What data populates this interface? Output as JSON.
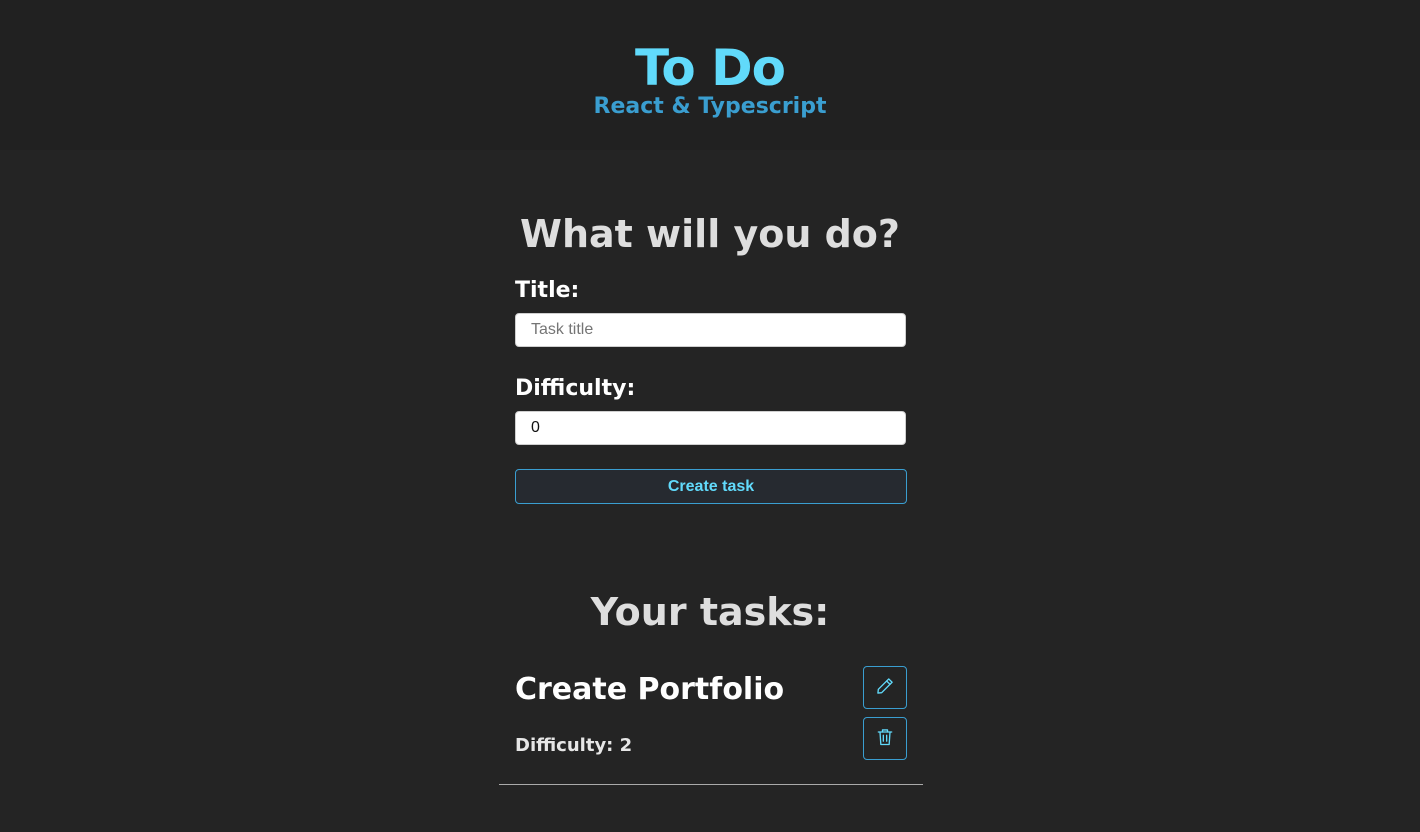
{
  "header": {
    "title": "To Do",
    "subtitle": "React & Typescript"
  },
  "form": {
    "heading": "What will you do?",
    "title_label": "Title:",
    "title_value": "",
    "title_placeholder": "Task title",
    "difficulty_label": "Difficulty:",
    "difficulty_value": "0",
    "submit_label": "Create task"
  },
  "tasks": {
    "heading": "Your tasks:",
    "items": [
      {
        "title": "Create Portfolio",
        "difficulty_text": "Difficulty: 2",
        "edit_icon": "pencil-icon",
        "delete_icon": "trash-icon"
      }
    ]
  },
  "colors": {
    "background": "#242424",
    "header_background": "#212121",
    "accent": "#61dafb",
    "accent_dark": "#3a9ed0"
  }
}
